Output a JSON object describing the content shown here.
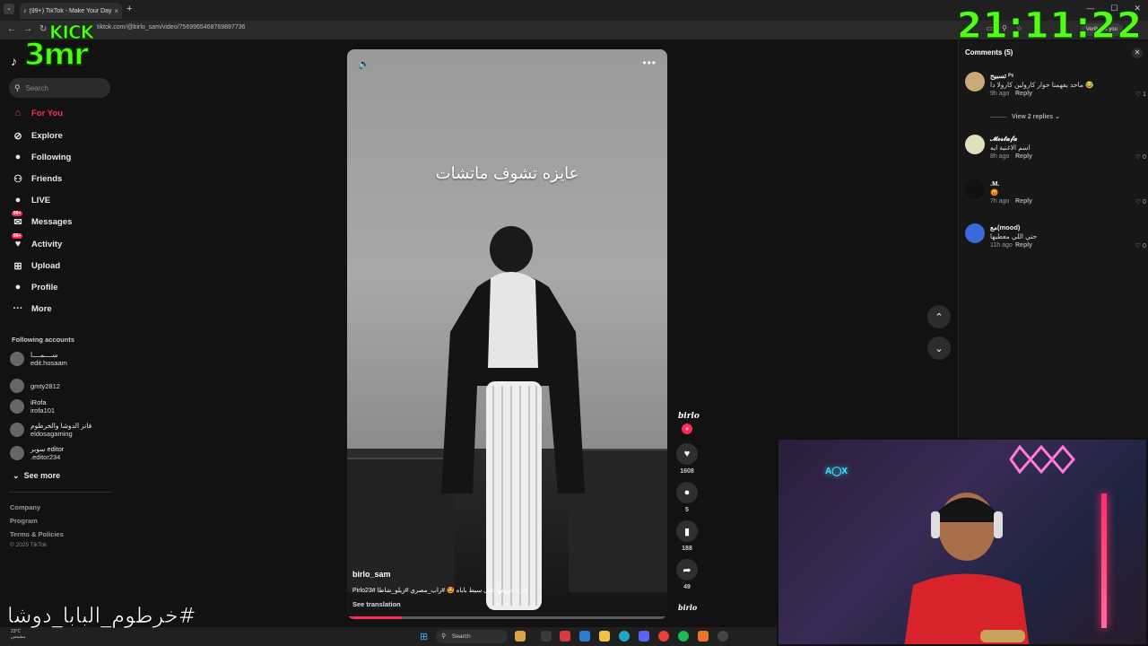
{
  "browser": {
    "tab_title": "(99+) TikTok - Make Your Day",
    "url": "tiktok.com/@birlo_sam/video/7569965468769897736",
    "verify_label": "Verify it's you",
    "new_tab": "+",
    "tab_close": "×"
  },
  "overlays": {
    "logo_top": "KICK",
    "logo_bottom": "3mr",
    "clock": "21:11:22",
    "hashtag": "#خرطوم_البابا_دوشا"
  },
  "sidebar": {
    "search_placeholder": "Search",
    "nav": [
      {
        "label": "For You",
        "icon": "home-icon",
        "glyph": "⌂",
        "active": true
      },
      {
        "label": "Explore",
        "icon": "compass-icon",
        "glyph": "⊘"
      },
      {
        "label": "Following",
        "icon": "following-avatar-icon",
        "glyph": "●"
      },
      {
        "label": "Friends",
        "icon": "friends-icon",
        "glyph": "⚇"
      },
      {
        "label": "LIVE",
        "icon": "live-avatar-icon",
        "glyph": "●"
      },
      {
        "label": "Messages",
        "icon": "messages-icon",
        "glyph": "✉",
        "badge": "99+"
      },
      {
        "label": "Activity",
        "icon": "activity-icon",
        "glyph": "♥",
        "badge": "99+"
      },
      {
        "label": "Upload",
        "icon": "upload-icon",
        "glyph": "⊞"
      },
      {
        "label": "Profile",
        "icon": "profile-avatar-icon",
        "glyph": "●"
      },
      {
        "label": "More",
        "icon": "more-icon",
        "glyph": "···"
      }
    ],
    "following_title": "Following accounts",
    "accounts": [
      {
        "name": "ســــمــــا",
        "handle": "edit.hosaam"
      },
      {
        "name": "",
        "handle": "gmty2812"
      },
      {
        "name": "iRofa",
        "handle": "irofa101"
      },
      {
        "name": "فانز الدوشا والخرطوم",
        "handle": "eldosagaming"
      },
      {
        "name": "سوبر editor",
        "handle": ".editor234"
      }
    ],
    "see_more": "See more",
    "footer": [
      "Company",
      "Program",
      "Terms & Policies"
    ],
    "copyright": "© 2025 TikTok"
  },
  "video": {
    "overlay_text": "عايزه تشوف ماتشات",
    "author": "birlo_sam",
    "caption": "الولد حريفها على سيط باباه 🤩 #راب_مصري #زيلو_شاطا #Pirlo23",
    "see_translation": "See translation",
    "progress": 0.17,
    "creator_label": "birlo",
    "music_label": "birlo",
    "likes": "1608",
    "comments": "5",
    "saves": "188",
    "shares": "49"
  },
  "comments": {
    "title": "Comments (5)",
    "view_replies": "View 2 replies",
    "items": [
      {
        "user": "تسبيح ᴾˢ",
        "text": "ماحد يفهمنا حوار كارولين كارولا دا 😂",
        "time": "9h ago",
        "reply": "Reply",
        "likes": "1"
      },
      {
        "user": "𝓜𝓸𝓼𝓽𝓪𝓯𝓪",
        "text": "اسم الاغنية ايه",
        "time": "8h ago",
        "reply": "Reply",
        "likes": "0"
      },
      {
        "user": ".M.",
        "text": "😡",
        "time": "7h ago",
        "reply": "Reply",
        "likes": "0"
      },
      {
        "user": "مع(mood)",
        "text": "حتي اللي معطيها",
        "time": "11h ago",
        "reply": "Reply",
        "likes": "0"
      }
    ]
  },
  "taskbar": {
    "weather": "23°C",
    "weather_sub": "مشمس",
    "search": "Search"
  },
  "colors": {
    "accent": "#fe2c55",
    "overlay_green": "#53fc18"
  }
}
